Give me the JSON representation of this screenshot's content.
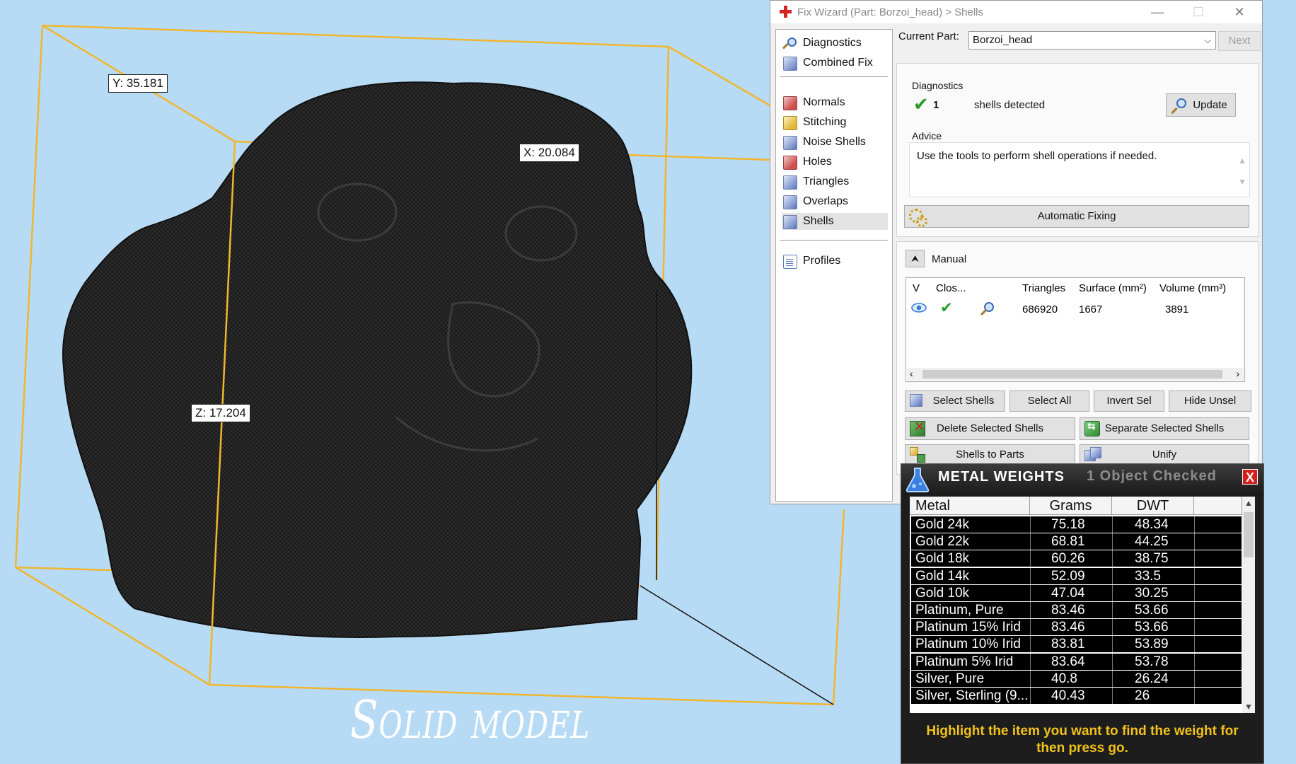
{
  "viewport": {
    "dim_y": "Y: 35.181",
    "dim_x": "X: 20.084",
    "dim_z": "Z: 17.204",
    "caption": "Solid model"
  },
  "fix_wizard": {
    "title": "Fix Wizard (Part: Borzoi_head) > Shells",
    "nav": {
      "diagnostics": "Diagnostics",
      "combined_fix": "Combined Fix",
      "normals": "Normals",
      "stitching": "Stitching",
      "noise_shells": "Noise Shells",
      "holes": "Holes",
      "triangles": "Triangles",
      "overlaps": "Overlaps",
      "shells": "Shells",
      "profiles": "Profiles"
    },
    "current_part_label": "Current Part:",
    "current_part_value": "Borzoi_head",
    "next_button": "Next",
    "diagnostics_group": "Diagnostics",
    "shells_count": "1",
    "shells_detected": "shells detected",
    "update_button": "Update",
    "advice_label": "Advice",
    "advice_text": "Use the tools to perform shell operations if needed.",
    "automatic_fixing": "Automatic Fixing",
    "manual_label": "Manual",
    "table": {
      "headers": {
        "v": "V",
        "closed": "Clos...",
        "triangles": "Triangles",
        "surface": "Surface (mm²)",
        "volume": "Volume (mm³)"
      },
      "row": {
        "triangles": "686920",
        "surface": "1667",
        "volume": "3891"
      }
    },
    "buttons": {
      "select_shells": "Select Shells",
      "select_all": "Select All",
      "invert_sel": "Invert Sel",
      "hide_unsel": "Hide Unsel",
      "delete_selected": "Delete Selected Shells",
      "separate_selected": "Separate Selected Shells",
      "shells_to_parts": "Shells to Parts",
      "unify": "Unify"
    }
  },
  "metal_weights": {
    "title": "METAL WEIGHTS",
    "status": "1 Object Checked",
    "close": "X",
    "headers": {
      "metal": "Metal",
      "grams": "Grams",
      "dwt": "DWT"
    },
    "rows": [
      {
        "metal": "Gold 24k",
        "grams": "75.18",
        "dwt": "48.34"
      },
      {
        "metal": "Gold 22k",
        "grams": "68.81",
        "dwt": "44.25"
      },
      {
        "metal": "Gold 18k",
        "grams": "60.26",
        "dwt": "38.75"
      },
      {
        "metal": "Gold 14k",
        "grams": "52.09",
        "dwt": "33.5"
      },
      {
        "metal": "Gold 10k",
        "grams": "47.04",
        "dwt": "30.25"
      },
      {
        "metal": "Platinum, Pure",
        "grams": "83.46",
        "dwt": "53.66"
      },
      {
        "metal": "Platinum 15% Irid",
        "grams": "83.46",
        "dwt": "53.66"
      },
      {
        "metal": "Platinum 10% Irid",
        "grams": "83.81",
        "dwt": "53.89"
      },
      {
        "metal": "Platinum 5% Irid",
        "grams": "83.64",
        "dwt": "53.78"
      },
      {
        "metal": "Silver, Pure",
        "grams": "40.8",
        "dwt": "26.24"
      },
      {
        "metal": "Silver, Sterling (9...",
        "grams": "40.43",
        "dwt": "26"
      }
    ],
    "message_line1": "Highlight the item you want to find the weight for",
    "message_line2": "then press go."
  },
  "colors": {
    "background": "#b8dbf5",
    "bbox_line": "#f0b62e",
    "model": "#1c1c1c",
    "check_green": "#2a9a2a",
    "warning_yellow": "#f2c21a"
  }
}
